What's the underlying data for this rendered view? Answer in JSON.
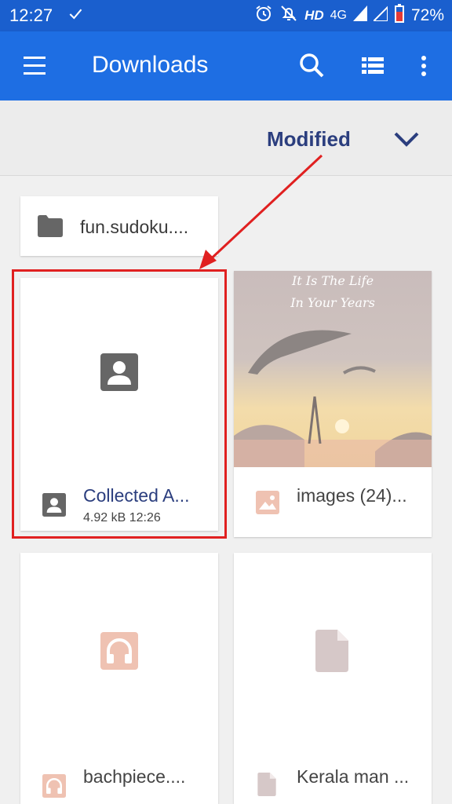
{
  "status": {
    "time": "12:27",
    "hd": "HD",
    "network": "4G",
    "battery": "72%"
  },
  "appbar": {
    "title": "Downloads"
  },
  "sort": {
    "label": "Modified"
  },
  "folder": {
    "name": "fun.sudoku...."
  },
  "files": [
    {
      "name": "Collected A...",
      "meta": "4.92 kB  12:26",
      "type": "contact"
    },
    {
      "name": "images (24)...",
      "type": "image",
      "thumb_text_1": "It Is The Life",
      "thumb_text_2": "In Your Years"
    },
    {
      "name": "bachpiece....",
      "type": "audio"
    },
    {
      "name": "Kerala man ...",
      "type": "document"
    }
  ],
  "colors": {
    "statusbar": "#1a5fce",
    "appbar": "#1e6ee3",
    "sort_label": "#2b3e7e",
    "highlight": "#e02020"
  }
}
